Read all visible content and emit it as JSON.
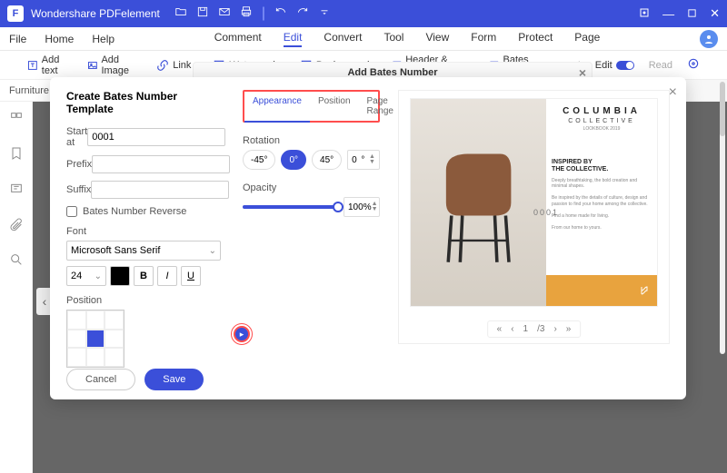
{
  "titlebar": {
    "app_name": "Wondershare PDFelement"
  },
  "menubar": {
    "left": {
      "file": "File",
      "home": "Home",
      "help": "Help"
    },
    "center": {
      "comment": "Comment",
      "edit": "Edit",
      "convert": "Convert",
      "tool": "Tool",
      "view": "View",
      "form": "Form",
      "protect": "Protect",
      "page": "Page"
    }
  },
  "toolbar": {
    "add_text": "Add text",
    "add_image": "Add Image",
    "link": "Link",
    "watermark": "Watermark",
    "background": "Background",
    "header_footer": "Header & Footer",
    "bates_number": "Bates Number",
    "edit": "Edit",
    "read": "Read"
  },
  "tab": {
    "filename": "Furniture.pdf"
  },
  "dialog_header": {
    "title": "Add Bates Number"
  },
  "modal": {
    "title": "Create Bates Number Template",
    "start_at_label": "Start at",
    "start_at_value": "0001",
    "prefix_label": "Prefix",
    "prefix_value": "",
    "suffix_label": "Suffix",
    "suffix_value": "",
    "reverse_label": "Bates Number Reverse",
    "font_label": "Font",
    "font_name": "Microsoft Sans Serif",
    "font_size": "24",
    "position_label": "Position",
    "tabs": {
      "appearance": "Appearance",
      "position": "Position",
      "page_range": "Page Range"
    },
    "rotation_label": "Rotation",
    "rot_m45": "-45°",
    "rot_0": "0°",
    "rot_45": "45°",
    "rot_custom": "0",
    "opacity_label": "Opacity",
    "opacity_value": "100",
    "opacity_unit": "%",
    "cancel": "Cancel",
    "save": "Save"
  },
  "preview": {
    "brand": "COLUMBIA",
    "sub": "COLLECTIVE",
    "book": "LOOKBOOK 2019",
    "headline1": "INSPIRED BY",
    "headline2": "THE COLLECTIVE.",
    "bates_mark": "0001",
    "page_current": "1",
    "page_total": "/3"
  }
}
